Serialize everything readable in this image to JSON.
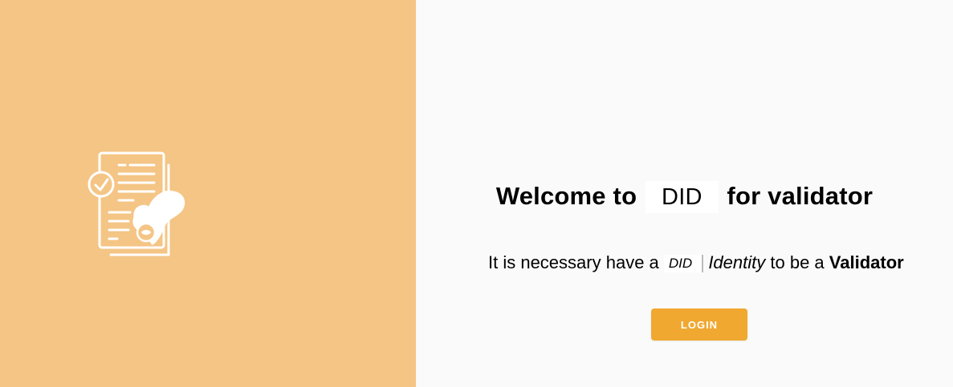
{
  "colors": {
    "left_panel_bg": "#f4c585",
    "right_panel_bg": "#fafafa",
    "accent": "#f0a830",
    "text": "#000000"
  },
  "illustration": {
    "icon": "document-validation-stamp-icon"
  },
  "welcome": {
    "prefix": "Welcome to",
    "brand": "DID",
    "suffix": "for validator"
  },
  "requirement": {
    "prefix": "It is necessary have a",
    "brand": "DID",
    "identity": "Identity",
    "middle": "to be a",
    "role": "Validator"
  },
  "login": {
    "label": "LOGIN"
  }
}
